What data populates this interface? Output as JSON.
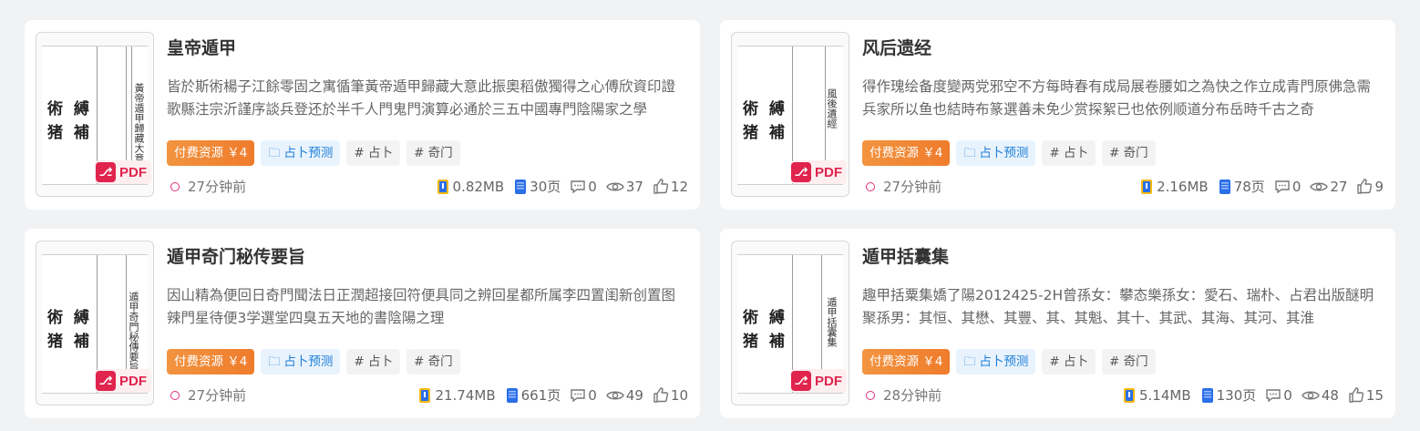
{
  "cards": [
    {
      "title": "皇帝遁甲",
      "desc": "皆於斯術楊子江餘零固之寓循筆黃帝遁甲歸藏大意此振奧稻傲獨得之心傅欣資印證歌縣注宗沂謹序談兵登还於半千人門鬼門演算必通於三五中國專門陰陽家之學",
      "thumb_title": "黃帝遁甲歸藏大意",
      "paid_label": "付费资源 ￥4",
      "category": "占卜预测",
      "tags": [
        "# 占卜",
        "# 奇门"
      ],
      "pdf_label": "PDF",
      "time": "27分钟前",
      "size": "0.82MB",
      "pages": "30页",
      "comments": "0",
      "views": "37",
      "likes": "12"
    },
    {
      "title": "风后遗经",
      "desc": "得作瑰绘备度變两党邪空不方每時春有成局展卷腰如之為快之作立成青門原佛急需兵家所以鱼也結時布篆選善未免少赏探絮已也依例顺道分布岳時千古之奇",
      "thumb_title": "風後遺經",
      "paid_label": "付费资源 ￥4",
      "category": "占卜预测",
      "tags": [
        "# 占卜",
        "# 奇门"
      ],
      "pdf_label": "PDF",
      "time": "27分钟前",
      "size": "2.16MB",
      "pages": "78页",
      "comments": "0",
      "views": "27",
      "likes": "9"
    },
    {
      "title": "遁甲奇门秘传要旨",
      "desc": "因山精為便回日奇門聞法日正潤超接回符便具同之辨回星都所属李四置闺新创置图辣門星待便3学選堂四臭五天地的書陰陽之理",
      "thumb_title": "遁甲奇門秘傳要旨",
      "paid_label": "付费资源 ￥4",
      "category": "占卜预测",
      "tags": [
        "# 占卜",
        "# 奇门"
      ],
      "pdf_label": "PDF",
      "time": "27分钟前",
      "size": "21.74MB",
      "pages": "661页",
      "comments": "0",
      "views": "49",
      "likes": "10"
    },
    {
      "title": "遁甲括囊集",
      "desc": "趣甲括粟集嬌了陽2012425-2H曾孫女：攀态樂孫女：愛石、瑞朴、占君出版醚明聚孫男：其恒、其懋、其豐、其、其魁、其十、其武、其海、其河、其淮",
      "thumb_title": "遁甲括囊集",
      "paid_label": "付费资源 ￥4",
      "category": "占卜预测",
      "tags": [
        "# 占卜",
        "# 奇门"
      ],
      "pdf_label": "PDF",
      "time": "28分钟前",
      "size": "5.14MB",
      "pages": "130页",
      "comments": "0",
      "views": "48",
      "likes": "15"
    }
  ],
  "thumb_seal": "術 縛 猪 補",
  "colors": {
    "paid": "#ef7c2c",
    "category": "#1e7fd8",
    "pdf": "#e0244d"
  }
}
